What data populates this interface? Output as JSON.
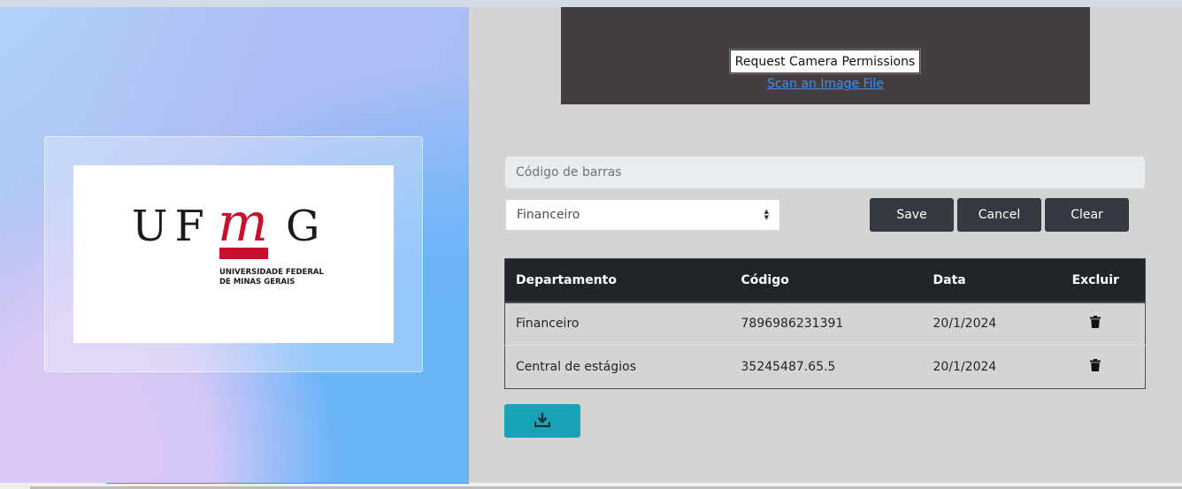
{
  "logo": {
    "letters_left": "UF",
    "letter_m": "m",
    "letter_g": "G",
    "line1": "UNIVERSIDADE FEDERAL",
    "line2": "DE MINAS GERAIS",
    "brand_color": "#c8102e"
  },
  "camera": {
    "request_button": "Request Camera Permissions",
    "scan_link": "Scan an Image File"
  },
  "form": {
    "barcode_placeholder": "Código de barras",
    "department_selected": "Financeiro",
    "save_label": "Save",
    "cancel_label": "Cancel",
    "clear_label": "Clear"
  },
  "table": {
    "headers": {
      "departamento": "Departamento",
      "codigo": "Código",
      "data": "Data",
      "excluir": "Excluir"
    },
    "rows": [
      {
        "departamento": "Financeiro",
        "codigo": "7896986231391",
        "data": "20/1/2024"
      },
      {
        "departamento": "Central de estágios",
        "codigo": "35245487.65.5",
        "data": "20/1/2024"
      }
    ]
  },
  "icons": {
    "delete": "trash-icon",
    "download": "download-icon"
  },
  "colors": {
    "dark_button": "#343a40",
    "download_button": "#17a2b8",
    "table_header": "#212529",
    "link": "#3a8ef6"
  }
}
